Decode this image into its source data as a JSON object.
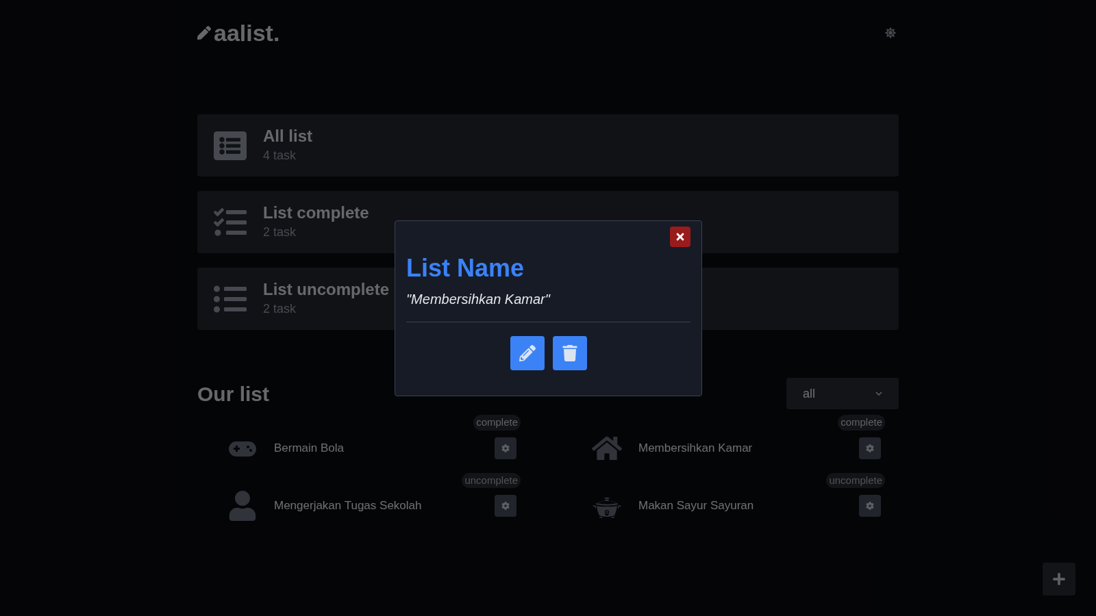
{
  "header": {
    "logo": "aalist."
  },
  "summary_cards": [
    {
      "title": "All list",
      "count": "4 task"
    },
    {
      "title": "List complete",
      "count": "2 task"
    },
    {
      "title": "List uncomplete",
      "count": "2 task"
    }
  ],
  "our_list": {
    "title": "Our list",
    "filter": {
      "value": "all"
    },
    "items": [
      {
        "name": "Bermain Bola",
        "status": "complete"
      },
      {
        "name": "Membersihkan Kamar",
        "status": "complete"
      },
      {
        "name": "Mengerjakan Tugas Sekolah",
        "status": "uncomplete"
      },
      {
        "name": "Makan Sayur Sayuran",
        "status": "uncomplete"
      }
    ]
  },
  "modal": {
    "title": "List Name",
    "subtitle": "\"Membersihkan Kamar\""
  }
}
